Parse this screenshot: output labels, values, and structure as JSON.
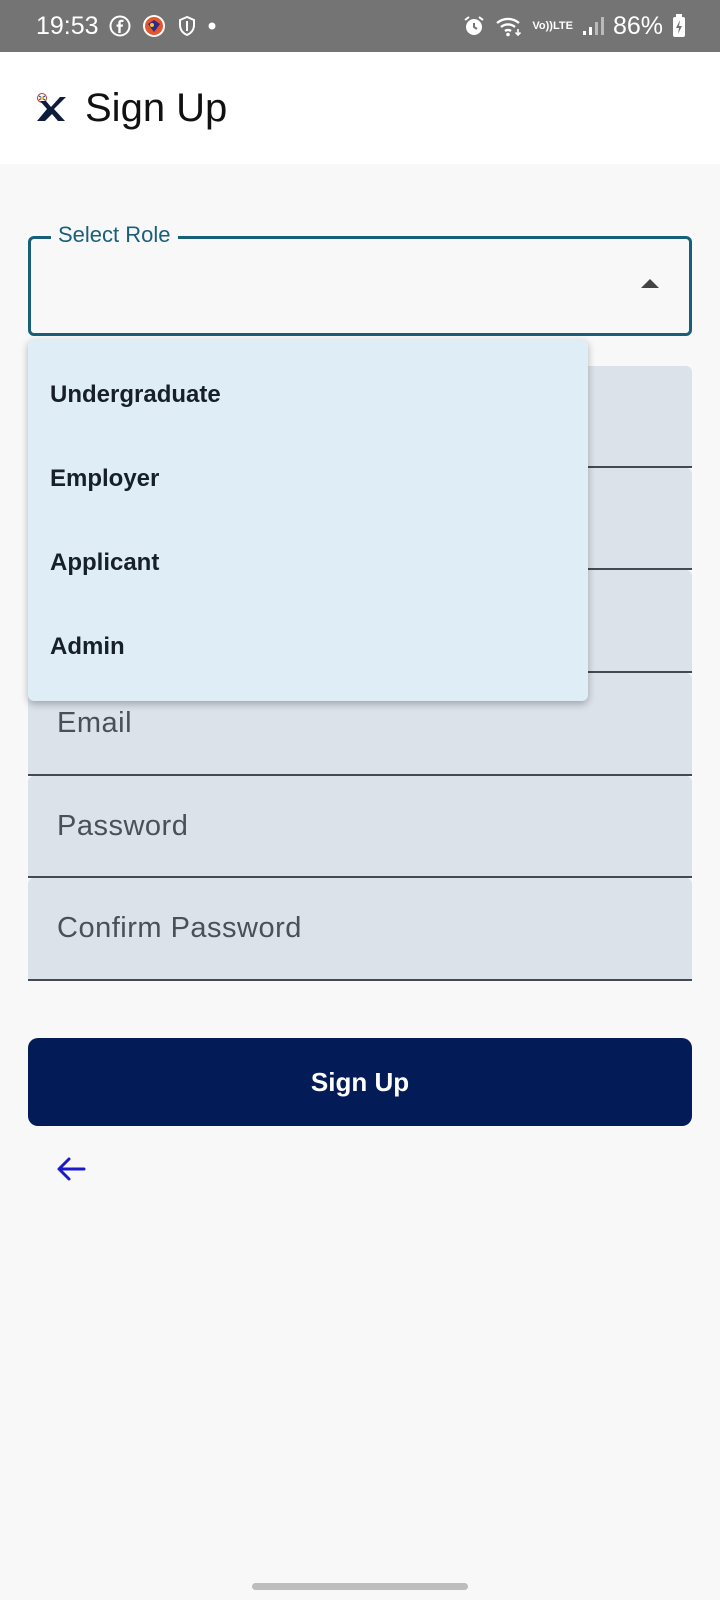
{
  "status_bar": {
    "time": "19:53",
    "network_label_top": "Vo))",
    "network_label_bottom": "LTE",
    "battery": "86%"
  },
  "app_bar": {
    "title": "Sign Up"
  },
  "role_select": {
    "label": "Select Role",
    "value": "",
    "options": [
      "Undergraduate",
      "Employer",
      "Applicant",
      "Admin"
    ]
  },
  "fields": {
    "email_placeholder": "Email",
    "password_placeholder": "Password",
    "confirm_password_placeholder": "Confirm Password"
  },
  "actions": {
    "signup_label": "Sign Up"
  },
  "colors": {
    "primary": "#031b57",
    "select_outline": "#1a5f7a",
    "field_fill": "#dce2ea",
    "menu_bg": "#dfeef6",
    "back_arrow": "#1a1ac8"
  }
}
